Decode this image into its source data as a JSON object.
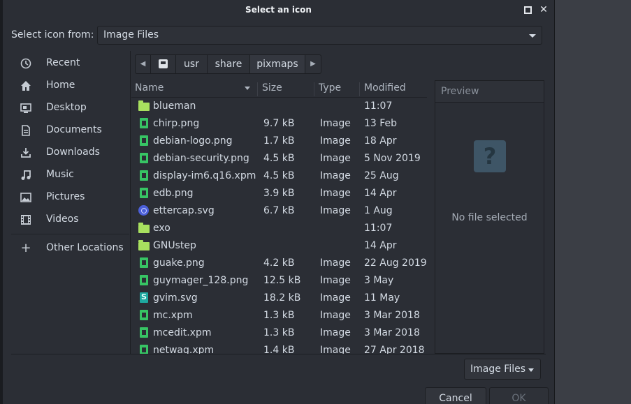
{
  "title": "Select an icon",
  "select_from": {
    "label": "Select icon from:",
    "value": "Image Files"
  },
  "sidebar": {
    "items": [
      {
        "label": "Recent",
        "icon": "clock-icon"
      },
      {
        "label": "Home",
        "icon": "home-icon"
      },
      {
        "label": "Desktop",
        "icon": "desktop-icon"
      },
      {
        "label": "Documents",
        "icon": "documents-icon"
      },
      {
        "label": "Downloads",
        "icon": "downloads-icon"
      },
      {
        "label": "Music",
        "icon": "music-icon"
      },
      {
        "label": "Pictures",
        "icon": "pictures-icon"
      },
      {
        "label": "Videos",
        "icon": "videos-icon"
      }
    ],
    "other_locations": "Other Locations"
  },
  "pathbar": {
    "segments": [
      "usr",
      "share",
      "pixmaps"
    ]
  },
  "columns": {
    "name": "Name",
    "size": "Size",
    "type": "Type",
    "modified": "Modified"
  },
  "files": [
    {
      "name": "blueman",
      "size": "",
      "type": "",
      "modified": "11:07",
      "kind": "folder"
    },
    {
      "name": "chirp.png",
      "size": "9.7 kB",
      "type": "Image",
      "modified": "13 Feb",
      "kind": "image"
    },
    {
      "name": "debian-logo.png",
      "size": "1.7 kB",
      "type": "Image",
      "modified": "18 Apr",
      "kind": "image"
    },
    {
      "name": "debian-security.png",
      "size": "4.5 kB",
      "type": "Image",
      "modified": "5 Nov 2019",
      "kind": "image"
    },
    {
      "name": "display-im6.q16.xpm",
      "size": "4.5 kB",
      "type": "Image",
      "modified": "25 Aug",
      "kind": "image"
    },
    {
      "name": "edb.png",
      "size": "3.9 kB",
      "type": "Image",
      "modified": "14 Apr",
      "kind": "image"
    },
    {
      "name": "ettercap.svg",
      "size": "6.7 kB",
      "type": "Image",
      "modified": "1 Aug",
      "kind": "ettercap"
    },
    {
      "name": "exo",
      "size": "",
      "type": "",
      "modified": "11:07",
      "kind": "folder"
    },
    {
      "name": "GNUstep",
      "size": "",
      "type": "",
      "modified": "14 Apr",
      "kind": "folder"
    },
    {
      "name": "guake.png",
      "size": "4.2 kB",
      "type": "Image",
      "modified": "22 Aug 2019",
      "kind": "image"
    },
    {
      "name": "guymager_128.png",
      "size": "12.5 kB",
      "type": "Image",
      "modified": "3 May",
      "kind": "image"
    },
    {
      "name": "gvim.svg",
      "size": "18.2 kB",
      "type": "Image",
      "modified": "11 May",
      "kind": "svg"
    },
    {
      "name": "mc.xpm",
      "size": "1.3 kB",
      "type": "Image",
      "modified": "3 Mar 2018",
      "kind": "image"
    },
    {
      "name": "mcedit.xpm",
      "size": "1.3 kB",
      "type": "Image",
      "modified": "3 Mar 2018",
      "kind": "image"
    },
    {
      "name": "netwag.xpm",
      "size": "1.4 kB",
      "type": "Image",
      "modified": "27 Apr 2018",
      "kind": "image"
    }
  ],
  "preview": {
    "header": "Preview",
    "empty_text": "No file selected",
    "placeholder_glyph": "?"
  },
  "filter": {
    "value": "Image Files"
  },
  "buttons": {
    "cancel": "Cancel",
    "ok": "OK"
  },
  "colors": {
    "folder": "#a8e05f",
    "image": "#37c464",
    "svg": "#1ea9a0",
    "ettercap": "#4b5fd8"
  }
}
